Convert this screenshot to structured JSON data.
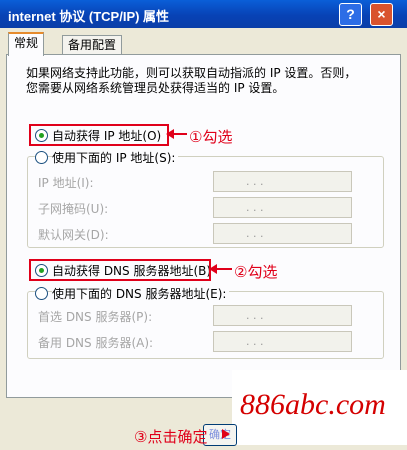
{
  "window": {
    "title": "internet 协议 (TCP/IP) 属性",
    "help_label": "?",
    "close_label": "×"
  },
  "tabs": [
    {
      "label": "常规",
      "active": true
    },
    {
      "label": "备用配置",
      "active": false
    }
  ],
  "description": {
    "line1": "如果网络支持此功能，则可以获取自动指派的 IP 设置。否则，",
    "line2": "您需要从网络系统管理员处获得适当的 IP 设置。"
  },
  "ip_section": {
    "auto_option": {
      "label": "自动获得 IP 地址(O)",
      "selected": true
    },
    "manual_option": {
      "label": "使用下面的 IP 地址(S):",
      "selected": false
    },
    "fields": [
      {
        "label": "IP 地址(I):",
        "value": ". . ."
      },
      {
        "label": "子网掩码(U):",
        "value": ". . ."
      },
      {
        "label": "默认网关(D):",
        "value": ". . ."
      }
    ]
  },
  "dns_section": {
    "auto_option": {
      "label": "自动获得 DNS 服务器地址(B)",
      "selected": true
    },
    "manual_option": {
      "label": "使用下面的 DNS 服务器地址(E):",
      "selected": false
    },
    "fields": [
      {
        "label": "首选 DNS 服务器(P):",
        "value": ". . ."
      },
      {
        "label": "备用 DNS 服务器(A):",
        "value": ". . ."
      }
    ]
  },
  "annotations": {
    "step1": "①勾选",
    "step2": "②勾选",
    "step3": "③点击确定"
  },
  "ok_button_label": "确定",
  "watermark": "886abc.com",
  "colors": {
    "annotation_red": "#e0001a",
    "titlebar_blue": "#0a5fd8",
    "radio_selected_green": "#21a121",
    "tab_highlight_orange": "#e68b2c"
  }
}
